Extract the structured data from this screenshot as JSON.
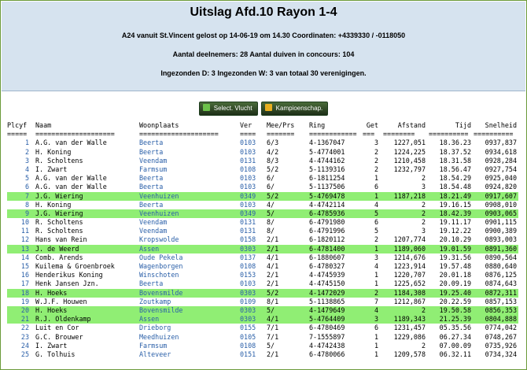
{
  "header": {
    "title": "Uitslag Afd.10 Rayon 1-4",
    "line1": "A24 vanuit St.Vincent gelost op 14-06-19 om 14.30 Coordinaten: +4339330 / -0118050",
    "line2": "Aantal deelnemers: 28 Aantal duiven in concours: 104",
    "line3": "Ingezonden D: 3 Ingezonden W: 3 van totaal 30 verenigingen."
  },
  "toolbar": {
    "select_flight": "Select. Vlucht",
    "championship": "Kampioenschap.",
    "select_icon": "dropdown-arrow-icon",
    "champ_icon": "crown-icon"
  },
  "table": {
    "headers": [
      "Plcyf",
      "Naam",
      "Woonplaats",
      "Ver",
      "Mee/Prs",
      "Ring",
      "Get",
      "Afstand",
      "Tijd",
      "Snelheid"
    ],
    "dashes": [
      "=====",
      "====================",
      "====================",
      "====",
      "=======",
      "============",
      "===",
      "========",
      "==========",
      "=========="
    ],
    "rows": [
      {
        "plc": "1",
        "naam": "A.G. van der Walle",
        "woon": "Beerta",
        "ver": "0103",
        "mee": "6/3",
        "ring": "4-1367047",
        "get": "3",
        "afst": "1227,051",
        "tijd": "18.36.23",
        "snel": "0937,837",
        "hl": false
      },
      {
        "plc": "2",
        "naam": "H. Koning",
        "woon": "Beerta",
        "ver": "0103",
        "mee": "4/2",
        "ring": "5-4774001",
        "get": "2",
        "afst": "1224,225",
        "tijd": "18.37.52",
        "snel": "0934,618",
        "hl": false
      },
      {
        "plc": "3",
        "naam": "R. Scholtens",
        "woon": "Veendam",
        "ver": "0131",
        "mee": "8/3",
        "ring": "4-4744162",
        "get": "2",
        "afst": "1210,458",
        "tijd": "18.31.58",
        "snel": "0928,284",
        "hl": false
      },
      {
        "plc": "4",
        "naam": "I. Zwart",
        "woon": "Farmsum",
        "ver": "0108",
        "mee": "5/2",
        "ring": "5-1139316",
        "get": "2",
        "afst": "1232,797",
        "tijd": "18.56.47",
        "snel": "0927,754",
        "hl": false
      },
      {
        "plc": "5",
        "naam": "A.G. van der Walle",
        "woon": "Beerta",
        "ver": "0103",
        "mee": "6/",
        "ring": "6-1811254",
        "get": "1",
        "afst": "2",
        "tijd": "18.54.29",
        "snel": "0925,040",
        "hl": false
      },
      {
        "plc": "6",
        "naam": "A.G. van der Walle",
        "woon": "Beerta",
        "ver": "0103",
        "mee": "6/",
        "ring": "5-1137506",
        "get": "6",
        "afst": "3",
        "tijd": "18.54.48",
        "snel": "0924,820",
        "hl": false
      },
      {
        "plc": "7",
        "naam": "J.G. Wiering",
        "woon": "Veenhuizen",
        "ver": "0349",
        "mee": "5/2",
        "ring": "5-4769478",
        "get": "1",
        "afst": "1187,218",
        "tijd": "18.21.49",
        "snel": "0917,607",
        "hl": true
      },
      {
        "plc": "8",
        "naam": "H. Koning",
        "woon": "Beerta",
        "ver": "0103",
        "mee": "4/",
        "ring": "4-4742114",
        "get": "4",
        "afst": "2",
        "tijd": "19.16.15",
        "snel": "0908,010",
        "hl": false
      },
      {
        "plc": "9",
        "naam": "J.G. Wiering",
        "woon": "Veenhuizen",
        "ver": "0349",
        "mee": "5/",
        "ring": "6-4785936",
        "get": "5",
        "afst": "2",
        "tijd": "18.42.39",
        "snel": "0903,065",
        "hl": true
      },
      {
        "plc": "10",
        "naam": "R. Scholtens",
        "woon": "Veendam",
        "ver": "0131",
        "mee": "8/",
        "ring": "6-4791980",
        "get": "6",
        "afst": "2",
        "tijd": "19.11.17",
        "snel": "0901,115",
        "hl": false
      },
      {
        "plc": "11",
        "naam": "R. Scholtens",
        "woon": "Veendam",
        "ver": "0131",
        "mee": "8/",
        "ring": "6-4791996",
        "get": "5",
        "afst": "3",
        "tijd": "19.12.22",
        "snel": "0900,389",
        "hl": false
      },
      {
        "plc": "12",
        "naam": "Hans van Rein",
        "woon": "Kropswolde",
        "ver": "0158",
        "mee": "2/1",
        "ring": "6-1820112",
        "get": "2",
        "afst": "1207,774",
        "tijd": "20.10.29",
        "snel": "0893,003",
        "hl": false
      },
      {
        "plc": "13",
        "naam": "J. de Weerd",
        "woon": "Assen",
        "ver": "0303",
        "mee": "2/1",
        "ring": "6-4781400",
        "get": "1",
        "afst": "1189,060",
        "tijd": "19.01.59",
        "snel": "0891,360",
        "hl": true
      },
      {
        "plc": "14",
        "naam": "Comb. Arends",
        "woon": "Oude Pekela",
        "ver": "0137",
        "mee": "4/1",
        "ring": "6-1880607",
        "get": "3",
        "afst": "1214,676",
        "tijd": "19.31.56",
        "snel": "0890,564",
        "hl": false
      },
      {
        "plc": "15",
        "naam": "Kuilema & Groenbroek",
        "woon": "Wagenborgen",
        "ver": "0108",
        "mee": "4/1",
        "ring": "6-4780327",
        "get": "4",
        "afst": "1223,914",
        "tijd": "19.57.48",
        "snel": "0880,640",
        "hl": false
      },
      {
        "plc": "16",
        "naam": "Henderikus Koning",
        "woon": "Winschoten",
        "ver": "0153",
        "mee": "2/1",
        "ring": "4-4745939",
        "get": "1",
        "afst": "1220,707",
        "tijd": "20.01.18",
        "snel": "0876,125",
        "hl": false
      },
      {
        "plc": "17",
        "naam": "Henk Jansen Jzn.",
        "woon": "Beerta",
        "ver": "0103",
        "mee": "2/1",
        "ring": "4-4745150",
        "get": "1",
        "afst": "1225,652",
        "tijd": "20.09.19",
        "snel": "0874,643",
        "hl": false
      },
      {
        "plc": "18",
        "naam": "H. Hoeks",
        "woon": "Bovensmilde",
        "ver": "0303",
        "mee": "5/2",
        "ring": "4-1472029",
        "get": "2",
        "afst": "1184,308",
        "tijd": "19.25.40",
        "snel": "0872,311",
        "hl": true
      },
      {
        "plc": "19",
        "naam": "W.J.F. Houwen",
        "woon": "Zoutkamp",
        "ver": "0109",
        "mee": "8/1",
        "ring": "5-1138865",
        "get": "7",
        "afst": "1212,867",
        "tijd": "20.22.59",
        "snel": "0857,153",
        "hl": false
      },
      {
        "plc": "20",
        "naam": "H. Hoeks",
        "woon": "Bovensmilde",
        "ver": "0303",
        "mee": "5/",
        "ring": "4-1479649",
        "get": "4",
        "afst": "2",
        "tijd": "19.50.58",
        "snel": "0856,353",
        "hl": true
      },
      {
        "plc": "21",
        "naam": "R.J. Oldenkamp",
        "woon": "Assen",
        "ver": "0303",
        "mee": "4/1",
        "ring": "5-4764409",
        "get": "3",
        "afst": "1189,343",
        "tijd": "21.25.39",
        "snel": "0804,888",
        "hl": true
      },
      {
        "plc": "22",
        "naam": "Luit en Cor",
        "woon": "Drieborg",
        "ver": "0155",
        "mee": "7/1",
        "ring": "6-4780469",
        "get": "6",
        "afst": "1231,457",
        "tijd": "05.35.56",
        "snel": "0774,042",
        "hl": false
      },
      {
        "plc": "23",
        "naam": "G.C. Brouwer",
        "woon": "Meedhuizen",
        "ver": "0105",
        "mee": "7/1",
        "ring": "7-1555897",
        "get": "1",
        "afst": "1229,086",
        "tijd": "06.27.34",
        "snel": "0748,267",
        "hl": false
      },
      {
        "plc": "24",
        "naam": "I. Zwart",
        "woon": "Farmsum",
        "ver": "0108",
        "mee": "5/",
        "ring": "4-4742438",
        "get": "1",
        "afst": "2",
        "tijd": "07.00.09",
        "snel": "0735,926",
        "hl": false
      },
      {
        "plc": "25",
        "naam": "G. Tolhuis",
        "woon": "Alteveer",
        "ver": "0151",
        "mee": "2/1",
        "ring": "6-4780066",
        "get": "1",
        "afst": "1209,578",
        "tijd": "06.32.11",
        "snel": "0734,324",
        "hl": false
      }
    ]
  },
  "colors": {
    "header_bg": "#d6e3ef",
    "highlight": "#90ee74",
    "link_blue": "#2a5fa8",
    "frame_border": "#6b9a3a"
  }
}
